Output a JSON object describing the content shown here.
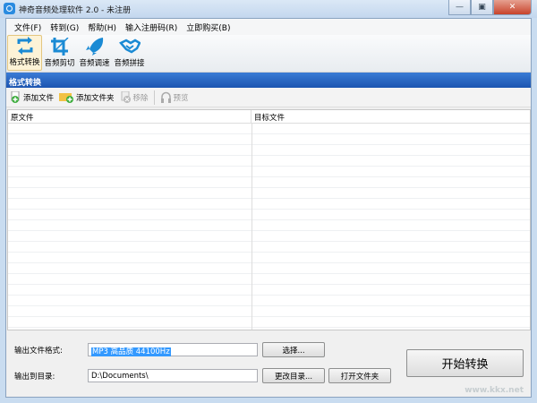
{
  "window": {
    "title": "神奇音频处理软件 2.0 - 未注册",
    "min": "—",
    "max": "▣",
    "close": "✕"
  },
  "menu": [
    "文件(F)",
    "转到(G)",
    "帮助(H)",
    "输入注册码(R)",
    "立即购买(B)"
  ],
  "toolbar": [
    {
      "label": "格式转换",
      "icon": "convert-icon"
    },
    {
      "label": "音频剪切",
      "icon": "crop-icon"
    },
    {
      "label": "音频调速",
      "icon": "rocket-icon"
    },
    {
      "label": "音频拼接",
      "icon": "handshake-icon"
    }
  ],
  "section_title": "格式转换",
  "subtoolbar": {
    "add_file": "添加文件",
    "add_folder": "添加文件夹",
    "remove": "移除",
    "preview": "预览"
  },
  "table": {
    "columns": [
      "原文件",
      "目标文件"
    ],
    "rows": []
  },
  "output": {
    "format_label": "输出文件格式:",
    "format_value": "MP3 高品质 44100Hz",
    "choose": "选择...",
    "dir_label": "输出到目录:",
    "dir_value": "D:\\Documents\\",
    "change_dir": "更改目录...",
    "open_folder": "打开文件夹",
    "start": "开始转换"
  },
  "watermark": "www.kkx.net",
  "colors": {
    "accent": "#1c55b0",
    "icon": "#1a8ad4"
  }
}
